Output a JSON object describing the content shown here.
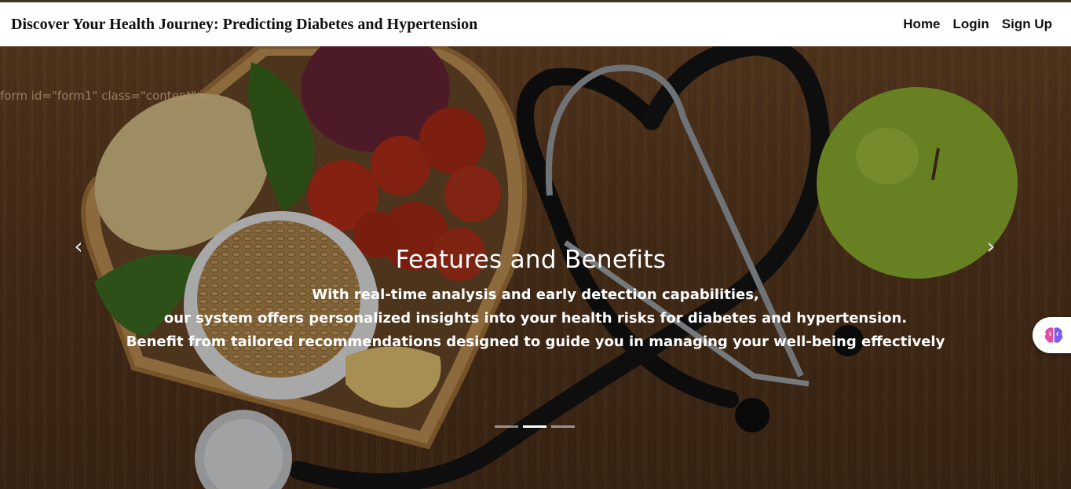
{
  "navbar": {
    "brand": "Discover Your Health Journey: Predicting Diabetes and Hypertension",
    "links": [
      "Home",
      "Login",
      "Sign Up"
    ]
  },
  "hero": {
    "stray_text": "form id=\"form1\" class=\"content\">",
    "caption": {
      "title": "Features and Benefits",
      "lines": [
        "With real-time analysis and early detection capabilities,",
        "our system offers personalized insights into your health risks for diabetes and hypertension.",
        "Benefit from tailored recommendations designed to guide you in managing your well-being effectively"
      ]
    },
    "prev_icon": "‹",
    "next_icon": "›",
    "slides_count": 3,
    "active_slide": 2
  },
  "chat_widget": {
    "icon": "brain-icon"
  }
}
